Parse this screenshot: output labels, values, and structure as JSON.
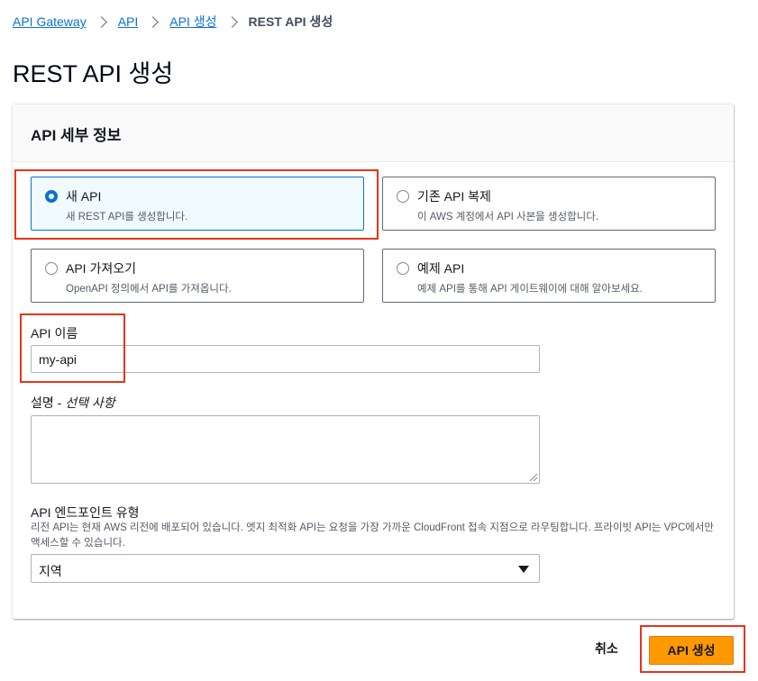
{
  "breadcrumb": {
    "items": [
      "API Gateway",
      "API",
      "API 생성"
    ],
    "current": "REST API 생성"
  },
  "page": {
    "title": "REST API 생성"
  },
  "details": {
    "title": "API 세부 정보",
    "options": [
      {
        "label": "새 API",
        "description": "새 REST API를 생성합니다.",
        "selected": true
      },
      {
        "label": "기존 API 복제",
        "description": "이 AWS 계정에서 API 사본을 생성합니다.",
        "selected": false
      },
      {
        "label": "API 가져오기",
        "description": "OpenAPI 정의에서 API를 가져옵니다.",
        "selected": false
      },
      {
        "label": "예제 API",
        "description": "예제 API를 통해 API 게이트웨이에 대해 알아보세요.",
        "selected": false
      }
    ]
  },
  "api_name": {
    "label": "API 이름",
    "value": "my-api"
  },
  "description_field": {
    "label": "설명 - ",
    "optional": "선택 사항",
    "value": ""
  },
  "endpoint": {
    "label": "API 엔드포인트 유형",
    "description": "리전 API는 현재 AWS 리전에 배포되어 있습니다. 엣지 최적화 API는 요청을 가장 가까운 CloudFront 접속 지점으로 라우팅합니다. 프라이빗 API는 VPC에서만 액세스할 수 있습니다.",
    "selected": "지역"
  },
  "actions": {
    "cancel_label": "취소",
    "create_label": "API 생성"
  },
  "colors": {
    "primary": "#ff9900",
    "link": "#0972d3",
    "highlight": "#e8331a"
  }
}
